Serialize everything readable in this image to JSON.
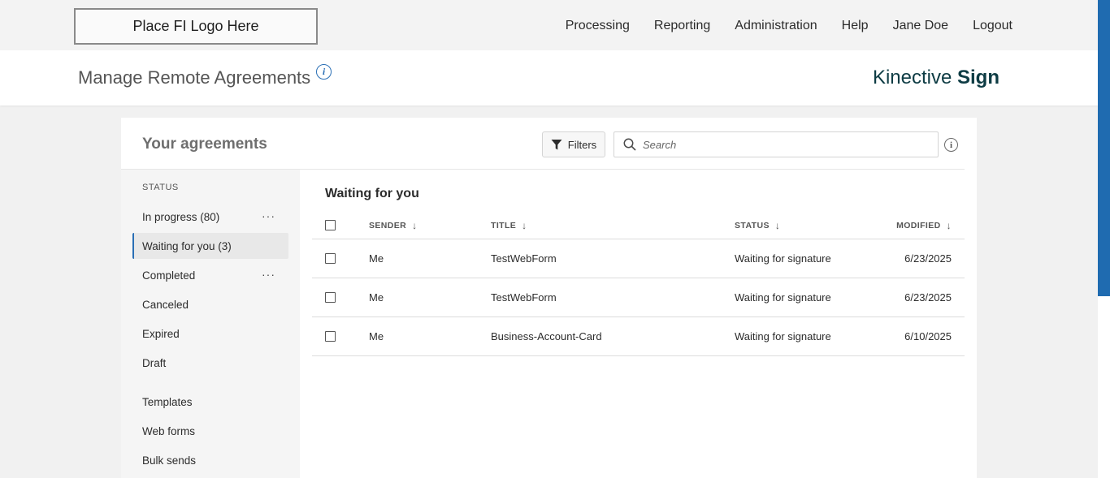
{
  "topbar": {
    "logo_text": "Place FI Logo Here",
    "nav": [
      "Processing",
      "Reporting",
      "Administration",
      "Help",
      "Jane Doe",
      "Logout"
    ]
  },
  "header": {
    "title": "Manage Remote Agreements",
    "info_icon": "i",
    "brand_light": "Kinective",
    "brand_bold": "Sign"
  },
  "card": {
    "title": "Your agreements",
    "filters_label": "Filters",
    "search_placeholder": "Search",
    "info_icon": "i"
  },
  "sidebar": {
    "status_heading": "STATUS",
    "status_items": [
      {
        "label": "In progress (80)",
        "menu": "···"
      },
      {
        "label": "Waiting for you (3)",
        "active": true
      },
      {
        "label": "Completed",
        "menu": "···"
      },
      {
        "label": "Canceled"
      },
      {
        "label": "Expired"
      },
      {
        "label": "Draft"
      }
    ],
    "other_items": [
      {
        "label": "Templates"
      },
      {
        "label": "Web forms"
      },
      {
        "label": "Bulk sends"
      }
    ]
  },
  "main": {
    "section_title": "Waiting for you",
    "columns": {
      "sender": "SENDER",
      "title": "TITLE",
      "status": "STATUS",
      "modified": "MODIFIED"
    },
    "rows": [
      {
        "sender": "Me",
        "title": "TestWebForm",
        "status": "Waiting for signature",
        "modified": "6/23/2025"
      },
      {
        "sender": "Me",
        "title": "TestWebForm",
        "status": "Waiting for signature",
        "modified": "6/23/2025"
      },
      {
        "sender": "Me",
        "title": "Business-Account-Card",
        "status": "Waiting for signature",
        "modified": "6/10/2025"
      }
    ]
  },
  "colors": {
    "accent": "#2a6fb5",
    "brand": "#0e3c44",
    "scrollbar": "#1f6bb0"
  }
}
